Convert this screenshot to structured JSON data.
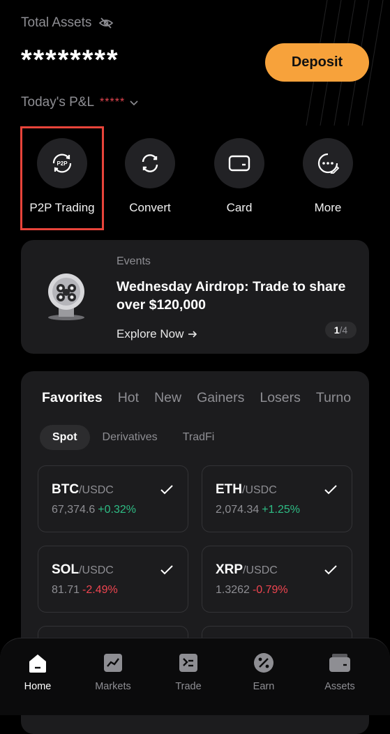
{
  "header": {
    "total_assets_label": "Total Assets",
    "masked_balance": "********",
    "deposit_label": "Deposit",
    "pnl_label": "Today's P&L",
    "pnl_masked": "*****"
  },
  "quick_actions": [
    {
      "label": "P2P Trading",
      "icon": "p2p-icon"
    },
    {
      "label": "Convert",
      "icon": "convert-icon"
    },
    {
      "label": "Card",
      "icon": "card-icon"
    },
    {
      "label": "More",
      "icon": "more-icon"
    }
  ],
  "event": {
    "kicker": "Events",
    "title": "Wednesday Airdrop: Trade to share over $120,000",
    "link": "Explore Now",
    "page_current": "1",
    "page_total": "/4"
  },
  "markets": {
    "tabs": [
      "Favorites",
      "Hot",
      "New",
      "Gainers",
      "Losers",
      "Turno"
    ],
    "subtabs": [
      "Spot",
      "Derivatives",
      "TradFi"
    ],
    "pairs": [
      {
        "base": "BTC",
        "quote": "/USDC",
        "price": "67,374.6",
        "change": "+0.32%",
        "direction": "up"
      },
      {
        "base": "ETH",
        "quote": "/USDC",
        "price": "2,074.34",
        "change": "+1.25%",
        "direction": "up"
      },
      {
        "base": "SOL",
        "quote": "/USDC",
        "price": "81.71",
        "change": "-2.49%",
        "direction": "down"
      },
      {
        "base": "XRP",
        "quote": "/USDC",
        "price": "1.3262",
        "change": "-0.79%",
        "direction": "down"
      }
    ]
  },
  "nav": [
    {
      "label": "Home",
      "icon": "home-icon",
      "active": true
    },
    {
      "label": "Markets",
      "icon": "markets-icon"
    },
    {
      "label": "Trade",
      "icon": "trade-icon"
    },
    {
      "label": "Earn",
      "icon": "earn-icon"
    },
    {
      "label": "Assets",
      "icon": "assets-icon"
    }
  ],
  "colors": {
    "accent": "#f7a23b",
    "up": "#2ebd85",
    "down": "#ef4550",
    "highlight": "#e8443a"
  }
}
